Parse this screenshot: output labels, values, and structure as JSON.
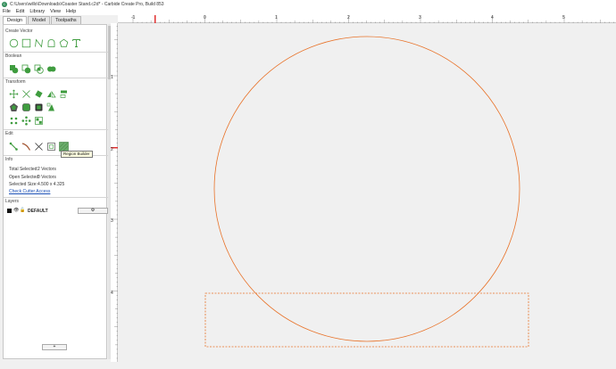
{
  "window": {
    "title": "C:\\Users\\willo\\Downloads\\Coaster Stand.c2d* - Carbide Create Pro, Build 853"
  },
  "menu": [
    "File",
    "Edit",
    "Library",
    "View",
    "Help"
  ],
  "tabs": [
    "Design",
    "Model",
    "Toolpaths"
  ],
  "sections": {
    "create_vector": "Create Vector",
    "boolean": "Boolean",
    "transform": "Transform",
    "edit": "Edit",
    "info": "Info",
    "layers": "Layers"
  },
  "tooltip": "Region Builder",
  "info": {
    "total_selected_label": "Total Selected:",
    "total_selected_value": "2 Vectors",
    "open_selected_label": "Open Selected:",
    "open_selected_value": "0 Vectors",
    "selected_size_label": "Selected Size:",
    "selected_size_value": "4.500 x 4.325",
    "check_link": "Check Cutter Access"
  },
  "layers": [
    {
      "name": "DEFAULT",
      "gear": "⚙"
    }
  ],
  "add_layer": "+",
  "ruler": {
    "h_labels": [
      "-1",
      "0",
      "1",
      "2",
      "3",
      "4",
      "5"
    ],
    "v_labels": [
      "1",
      "2",
      "3",
      "4"
    ]
  },
  "icons": {
    "create_vector": [
      "circle-icon",
      "rectangle-icon",
      "polyline-icon",
      "curve-icon",
      "polygon-icon",
      "text-icon"
    ],
    "boolean": [
      "union-icon",
      "subtract-icon",
      "intersect-icon",
      "weld-icon"
    ],
    "transform_row1": [
      "move-icon",
      "scale-icon",
      "rotate-icon",
      "mirror-icon",
      "align-icon"
    ],
    "transform_row2": [
      "offset-icon",
      "fillet-icon",
      "inset-icon",
      "array-icon"
    ],
    "transform_row3": [
      "grid-array-icon",
      "circular-array-icon",
      "nest-icon"
    ],
    "edit": [
      "node-edit-icon",
      "trim-icon",
      "cut-icon",
      "region-builder-icon",
      "region-builder-selected-icon"
    ]
  },
  "colors": {
    "vector_orange": "#e8732a",
    "icon_green": "#3f9c3f",
    "ruler_marker": "#e03030",
    "link_blue": "#1a4fb5"
  }
}
